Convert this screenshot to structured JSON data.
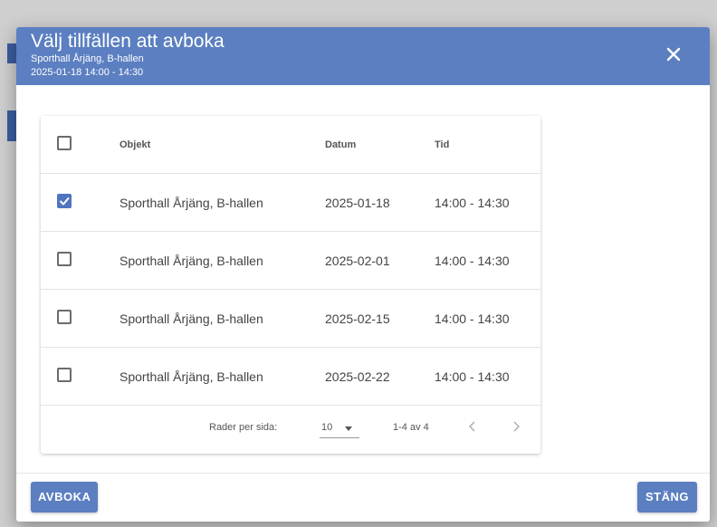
{
  "dialog": {
    "title": "Välj tillfällen att avboka",
    "subtitle_location": "Sporthall Årjäng, B-hallen",
    "subtitle_time": "2025-01-18 14:00 - 14:30",
    "close_icon": "close-icon"
  },
  "table": {
    "headers": {
      "object": "Objekt",
      "date": "Datum",
      "time": "Tid"
    },
    "rows": [
      {
        "checked": true,
        "object": "Sporthall Årjäng, B-hallen",
        "date": "2025-01-18",
        "time": "14:00 - 14:30"
      },
      {
        "checked": false,
        "object": "Sporthall Årjäng, B-hallen",
        "date": "2025-02-01",
        "time": "14:00 - 14:30"
      },
      {
        "checked": false,
        "object": "Sporthall Årjäng, B-hallen",
        "date": "2025-02-15",
        "time": "14:00 - 14:30"
      },
      {
        "checked": false,
        "object": "Sporthall Årjäng, B-hallen",
        "date": "2025-02-22",
        "time": "14:00 - 14:30"
      }
    ],
    "pagination": {
      "rows_per_page_label": "Rader per sida:",
      "rows_per_page_value": "10",
      "range": "1-4 av 4"
    }
  },
  "actions": {
    "cancel_booking": "AVBOKA",
    "close": "STÄNG"
  },
  "colors": {
    "accent": "#5b7fc1",
    "checkbox_checked": "#4f74c0"
  }
}
